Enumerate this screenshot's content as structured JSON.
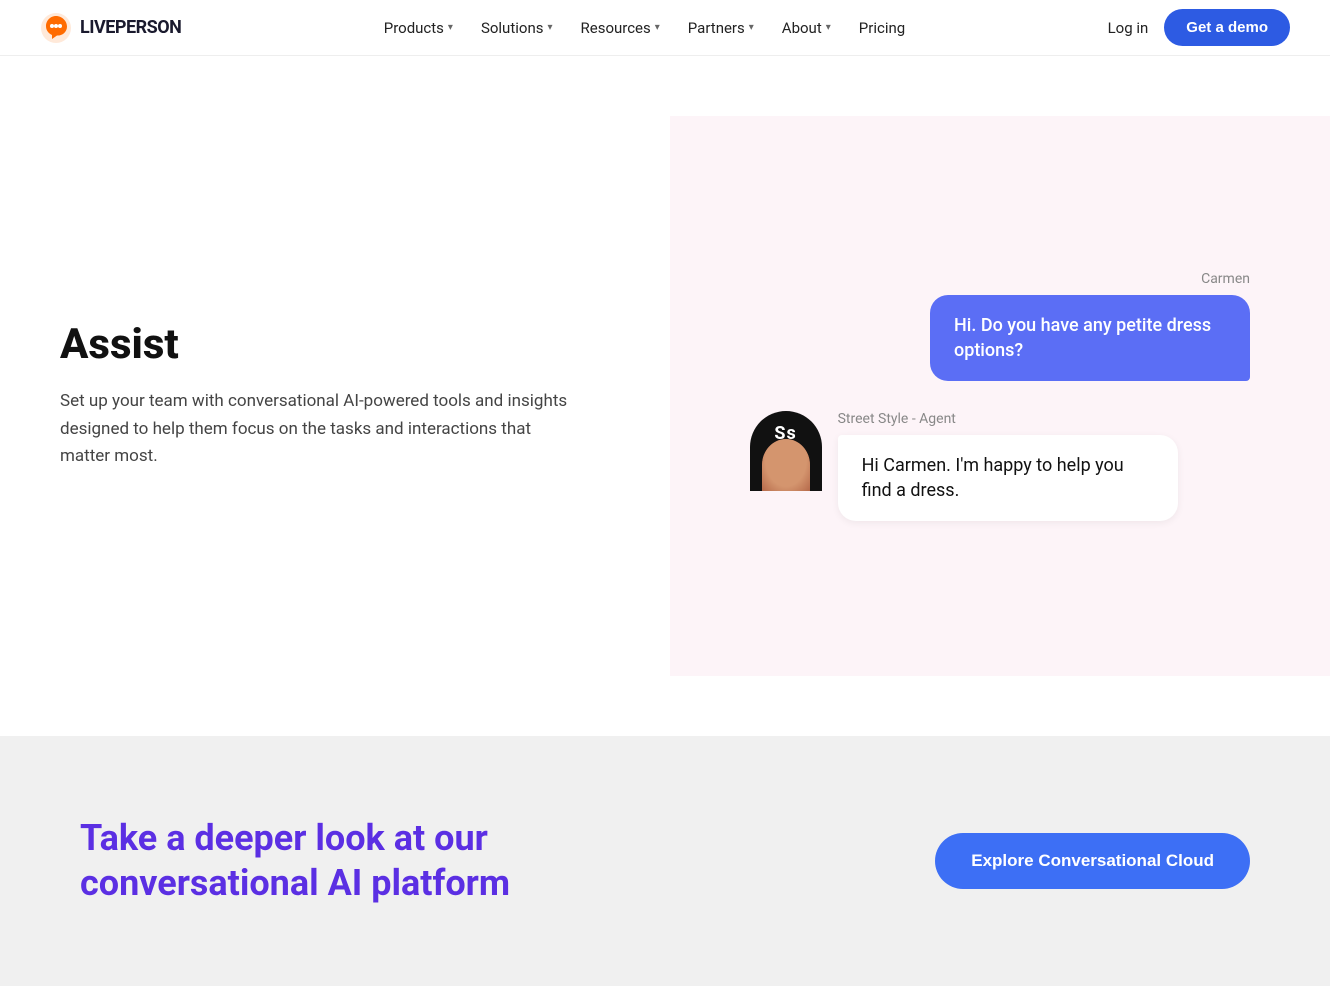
{
  "nav": {
    "logo_text": "LIVEPERSON",
    "links": [
      {
        "label": "Products",
        "has_chevron": true
      },
      {
        "label": "Solutions",
        "has_chevron": true
      },
      {
        "label": "Resources",
        "has_chevron": true
      },
      {
        "label": "Partners",
        "has_chevron": true
      },
      {
        "label": "About",
        "has_chevron": true
      },
      {
        "label": "Pricing",
        "has_chevron": false
      }
    ],
    "login_label": "Log in",
    "demo_label": "Get a demo"
  },
  "main": {
    "section_title": "Assist",
    "section_description": "Set up your team with conversational AI-powered tools and insights designed to help them focus on the tasks and interactions that matter most."
  },
  "chat": {
    "user_name": "Carmen",
    "user_message": "Hi. Do you have any petite dress options?",
    "agent_label": "Street Style - Agent",
    "agent_initials": "Ss",
    "agent_message": "Hi Carmen. I'm happy to help you find a dress."
  },
  "cta": {
    "headline": "Take a deeper look at our conversational AI platform",
    "button_label": "Explore Conversational Cloud"
  }
}
